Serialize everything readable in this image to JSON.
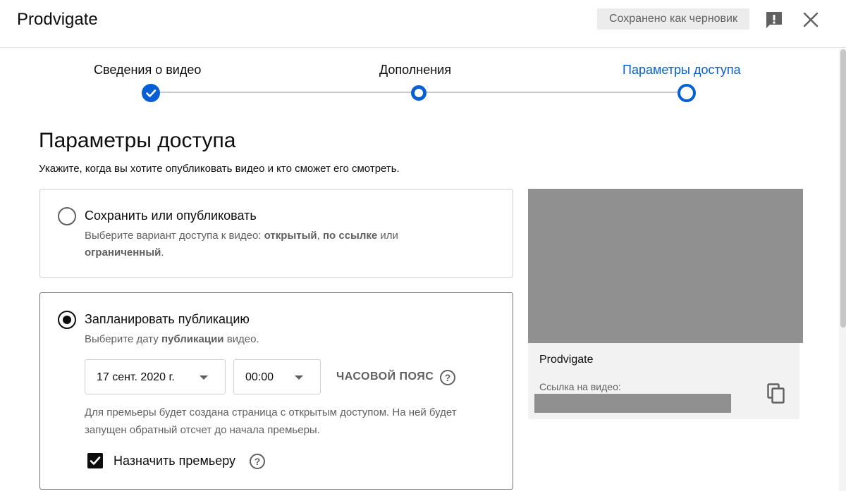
{
  "header": {
    "title": "Prodvigate",
    "draft_status": "Сохранено как черновик"
  },
  "stepper": {
    "steps": [
      {
        "label": "Сведения о видео",
        "state": "done"
      },
      {
        "label": "Дополнения",
        "state": "pending"
      },
      {
        "label": "Параметры доступа",
        "state": "current"
      }
    ]
  },
  "main": {
    "title": "Параметры доступа",
    "subtitle": "Укажите, когда вы хотите опубликовать видео и кто сможет его смотреть.",
    "options": [
      {
        "title": "Сохранить или опубликовать",
        "selected": false,
        "desc_prefix": "Выберите вариант доступа к видео: ",
        "desc_public": "открытый",
        "desc_sep": ", ",
        "desc_unlisted": "по ссылке",
        "desc_or": " или ",
        "desc_private": "ограниченный",
        "desc_end": "."
      },
      {
        "title": "Запланировать публикацию",
        "selected": true,
        "desc_prefix": "Выберите дату ",
        "desc_bold": "публикации",
        "desc_suffix": " видео.",
        "date_value": "17 сент. 2020 г.",
        "time_value": "00:00",
        "timezone_label": "ЧАСОВОЙ ПОЯС",
        "premiere_note": "Для премьеры будет создана страница с открытым доступом. На ней будет запущен обратный отсчет до начала премьеры.",
        "premiere_checkbox_label": "Назначить премьеру",
        "premiere_checked": true
      }
    ]
  },
  "preview": {
    "channel": "Prodvigate",
    "link_label": "Ссылка на видео:"
  },
  "icons": {
    "help": "?",
    "check": "check-icon",
    "copy": "copy-icon",
    "close": "close-icon",
    "feedback": "feedback-icon"
  },
  "colors": {
    "accent": "#065fd4",
    "text": "#0d0d0d",
    "secondary_text": "#606060",
    "placeholder_gray": "#909090"
  }
}
